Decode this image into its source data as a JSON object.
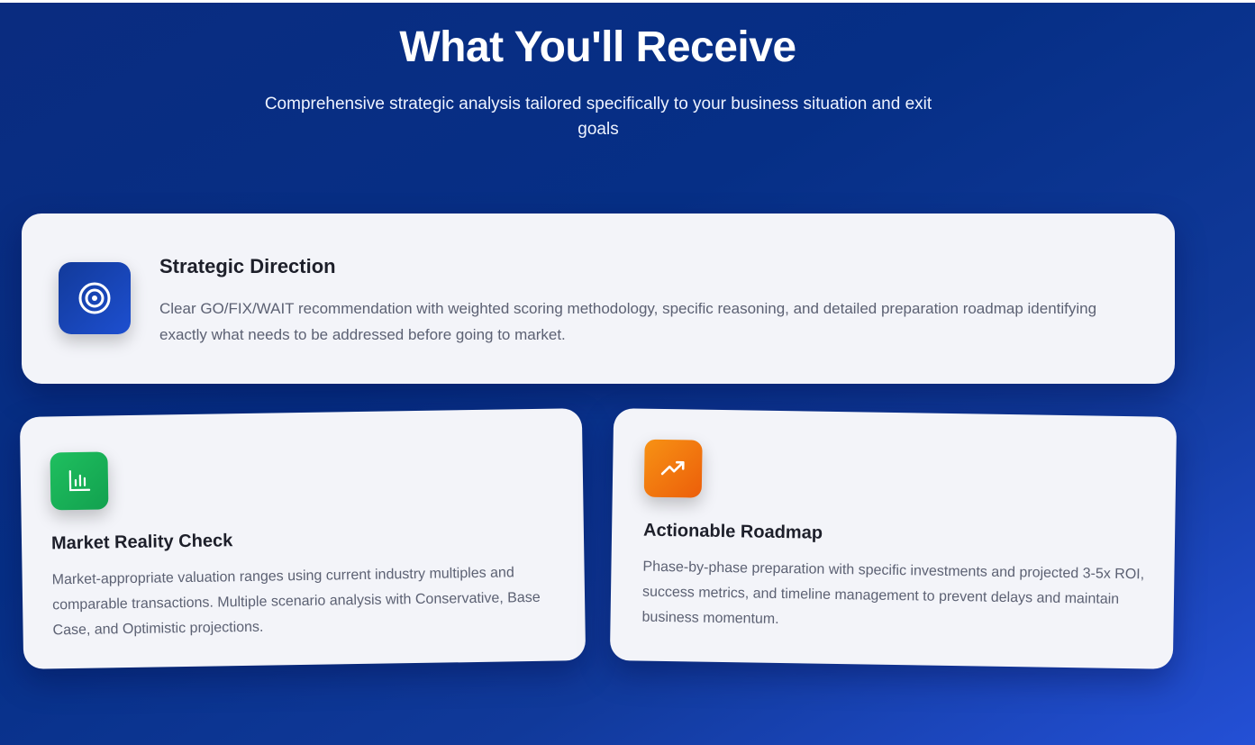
{
  "section": {
    "title": "What You'll Receive",
    "subtitle": "Comprehensive strategic analysis tailored specifically to your business situation and exit goals"
  },
  "cards": [
    {
      "icon": "target-icon",
      "title": "Strategic Direction",
      "description": "Clear GO/FIX/WAIT recommendation with weighted scoring methodology, specific reasoning, and detailed preparation roadmap identifying exactly what needs to be addressed before going to market."
    },
    {
      "icon": "bar-chart-icon",
      "title": "Market Reality Check",
      "description": "Market-appropriate valuation ranges using current industry multiples and comparable transactions. Multiple scenario analysis with Conservative, Base Case, and Optimistic projections."
    },
    {
      "icon": "trending-up-icon",
      "title": "Actionable Roadmap",
      "description": "Phase-by-phase preparation with specific investments and projected 3-5x ROI, success metrics, and timeline management to prevent delays and maintain business momentum."
    }
  ],
  "colors": {
    "background_start": "#0a2c80",
    "background_end": "#2450d6",
    "card": "#f3f4f9",
    "icon_blue": "#1d4fd0",
    "icon_green": "#1fbf5f",
    "icon_orange": "#f79214"
  }
}
